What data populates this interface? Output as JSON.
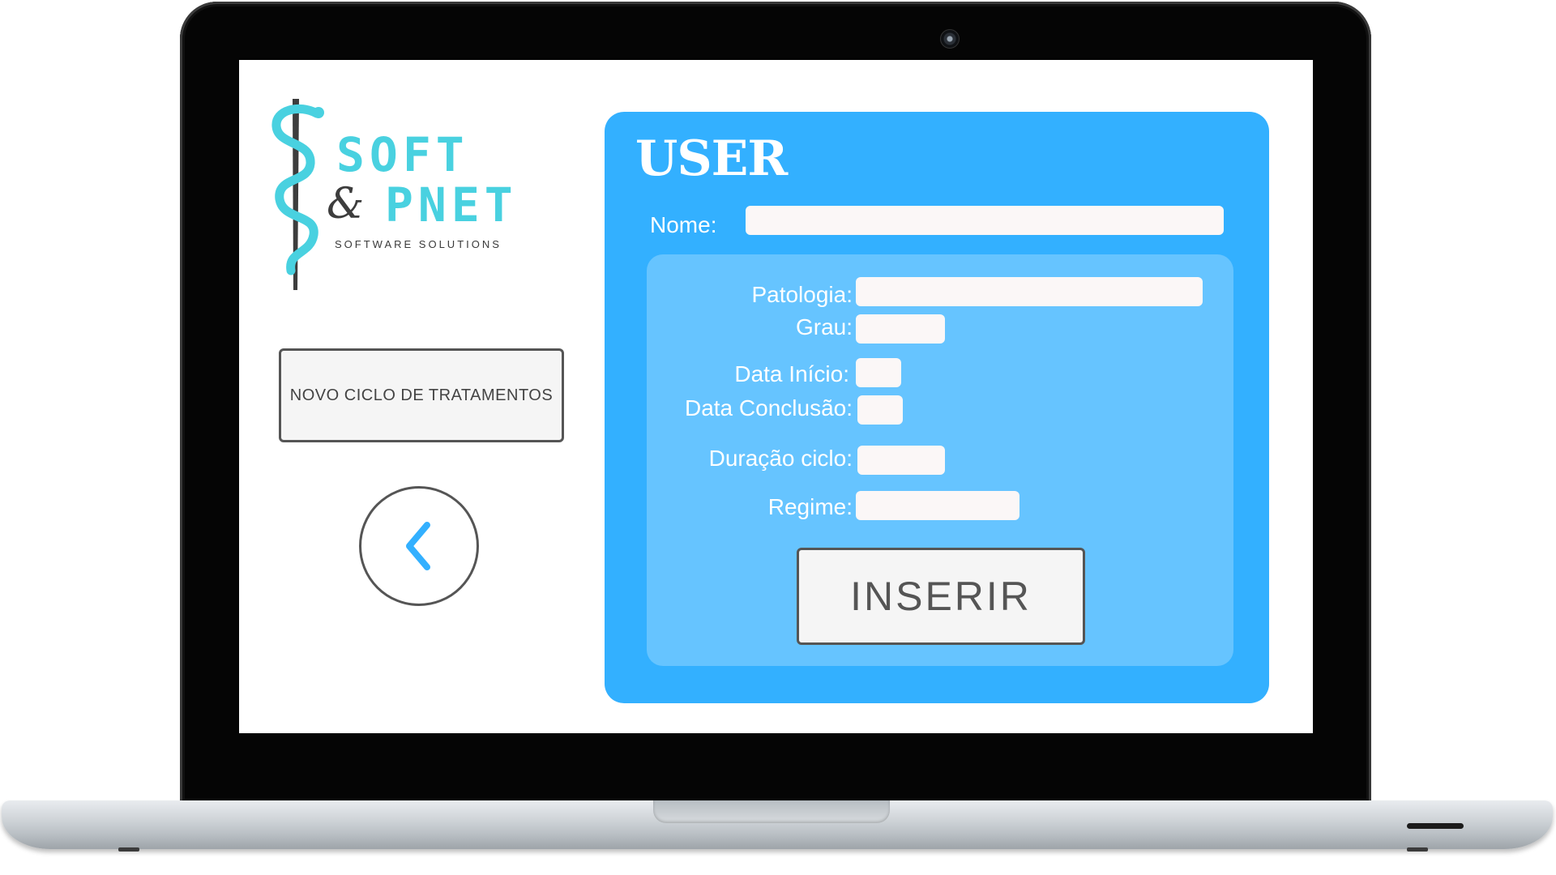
{
  "logo": {
    "word1": "SOFT",
    "amp": "&",
    "word2": "PNET",
    "tagline": "SOFTWARE SOLUTIONS"
  },
  "sidebar": {
    "novo_ciclo_label": "NOVO CICLO DE TRATAMENTOS",
    "back_icon": "chevron-left-icon"
  },
  "form": {
    "title": "USER",
    "nome_label": "Nome:",
    "nome_value": "",
    "patologia_label": "Patologia:",
    "patologia_value": "",
    "grau_label": "Grau:",
    "grau_value": "",
    "data_inicio_label": "Data Início:",
    "data_inicio_value": "",
    "data_conclusao_label": "Data Conclusão:",
    "data_conclusao_value": "",
    "duracao_label": "Duração ciclo:",
    "duracao_value": "",
    "regime_label": "Regime:",
    "regime_value": "",
    "submit_label": "INSERIR"
  },
  "colors": {
    "panel": "#33b0ff",
    "inner_panel": "#66c4ff",
    "logo_accent": "#49d1e0",
    "back_icon": "#33b0ff"
  }
}
